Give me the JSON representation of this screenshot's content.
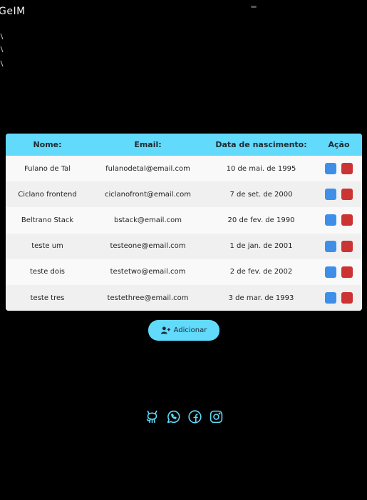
{
  "header": {
    "brand": "GeIM"
  },
  "table": {
    "columns": [
      "Nome:",
      "Email:",
      "Data de nascimento:",
      "Ação"
    ],
    "rows": [
      {
        "name": "Fulano de Tal",
        "email": "fulanodetal@email.com",
        "birth": "10 de mai. de 1995"
      },
      {
        "name": "Ciclano frontend",
        "email": "ciclanofront@email.com",
        "birth": "7 de set. de 2000"
      },
      {
        "name": "Beltrano Stack",
        "email": "bstack@email.com",
        "birth": "20 de fev. de 1990"
      },
      {
        "name": "teste um",
        "email": "testeone@email.com",
        "birth": "1 de jan. de 2001"
      },
      {
        "name": "teste dois",
        "email": "testetwo@email.com",
        "birth": "2 de fev. de 2002"
      },
      {
        "name": "teste tres",
        "email": "testethree@email.com",
        "birth": "3 de mar. de 1993"
      }
    ]
  },
  "add_button": {
    "label": "Adicionar",
    "icon": "user-plus-icon"
  },
  "socials": [
    {
      "icon": "github-icon"
    },
    {
      "icon": "whatsapp-icon"
    },
    {
      "icon": "facebook-icon"
    },
    {
      "icon": "instagram-icon"
    }
  ],
  "colors": {
    "accent": "#61dafb",
    "edit": "#3f8fe8",
    "delete": "#cc3333",
    "background": "#000000"
  }
}
